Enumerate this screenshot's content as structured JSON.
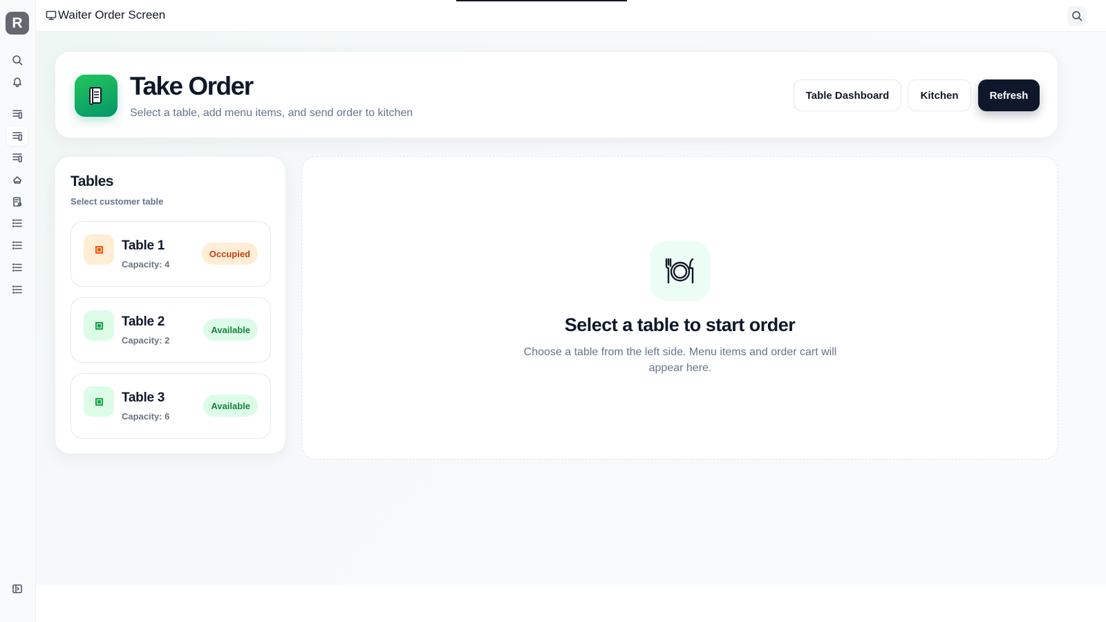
{
  "rail": {
    "logo_letter": "R",
    "items": [
      {
        "icon": "search-icon"
      },
      {
        "icon": "bell-icon"
      },
      {
        "icon": "list-panel-icon"
      },
      {
        "icon": "list-panel-icon"
      },
      {
        "icon": "list-panel-icon"
      },
      {
        "icon": "chef-hat-icon"
      },
      {
        "icon": "receipt-icon"
      },
      {
        "icon": "list-icon"
      },
      {
        "icon": "list-icon"
      },
      {
        "icon": "list-icon"
      },
      {
        "icon": "list-icon"
      }
    ],
    "bottom_icon": "sidebar-toggle-icon"
  },
  "topbar": {
    "title": "Waiter Order Screen",
    "title_icon": "monitor-icon",
    "search_icon": "search-icon"
  },
  "header": {
    "title": "Take Order",
    "subtitle": "Select a table, add menu items, and send order to kitchen",
    "icon": "order-scroll-icon",
    "buttons": {
      "table_dashboard": "Table Dashboard",
      "kitchen": "Kitchen",
      "refresh": "Refresh"
    }
  },
  "tables": {
    "title": "Tables",
    "subtitle": "Select customer table",
    "items": [
      {
        "name": "Table 1",
        "capacity": "Capacity: 4",
        "status": "Occupied"
      },
      {
        "name": "Table 2",
        "capacity": "Capacity: 2",
        "status": "Available"
      },
      {
        "name": "Table 3",
        "capacity": "Capacity: 6",
        "status": "Available"
      }
    ]
  },
  "empty_state": {
    "icon": "plate-utensils-icon",
    "title": "Select a table to start order",
    "description": "Choose a table from the left side. Menu items and order cart will appear here."
  },
  "colors": {
    "accent_green": "#10b981",
    "dark": "#0f172a",
    "occupied": "#ea580c",
    "available": "#16a34a"
  }
}
